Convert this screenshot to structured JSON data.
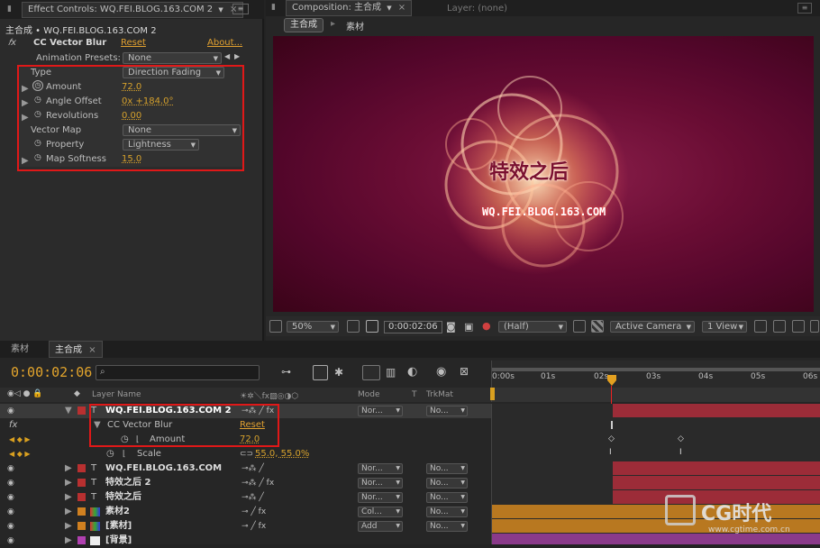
{
  "effect_panel": {
    "tab": "Effect Controls: WQ.FEI.BLOG.163.COM 2",
    "breadcrumb": "主合成 • WQ.FEI.BLOG.163.COM 2",
    "effect_name": "CC Vector Blur",
    "reset": "Reset",
    "about": "About...",
    "presets_label": "Animation Presets:",
    "presets_value": "None",
    "params": [
      {
        "label": "Type",
        "value": "Direction Fading"
      },
      {
        "label": "Amount",
        "value": "72.0"
      },
      {
        "label": "Angle Offset",
        "value": "0x +184.0°"
      },
      {
        "label": "Revolutions",
        "value": "0.00"
      },
      {
        "label": "Vector Map",
        "value": "None"
      },
      {
        "label": "Property",
        "value": "Lightness"
      },
      {
        "label": "Map Softness",
        "value": "15.0"
      }
    ]
  },
  "comp_panel": {
    "tab": "Composition: 主合成",
    "layer_tab": "Layer: (none)",
    "crumbs": [
      "主合成",
      "素材"
    ],
    "canvas_title": "特效之后",
    "canvas_subtitle": "WQ.FEI.BLOG.163.COM",
    "zoom": "50%",
    "timecode": "0:00:02:06",
    "resolution": "(Half)",
    "camera": "Active Camera",
    "view": "1 View"
  },
  "timeline": {
    "tabs": [
      "素材",
      "主合成"
    ],
    "timecode": "0:00:02:06",
    "search_placeholder": "",
    "col_layer": "Layer Name",
    "col_mode": "Mode",
    "col_t": "T",
    "col_trkmat": "TrkMat",
    "ruler": [
      "0:00s",
      "01s",
      "02s",
      "03s",
      "04s",
      "05s",
      "06s"
    ],
    "layers": [
      {
        "name": "WQ.FEI.BLOG.163.COM 2",
        "mode": "Nor...",
        "trk": "No...",
        "color": "#b83030",
        "type": "T"
      },
      {
        "name": "WQ.FEI.BLOG.163.COM",
        "mode": "Nor...",
        "trk": "No...",
        "color": "#b83030",
        "type": "T"
      },
      {
        "name": "特效之后 2",
        "mode": "Nor...",
        "trk": "No...",
        "color": "#b83030",
        "type": "T"
      },
      {
        "name": "特效之后",
        "mode": "Nor...",
        "trk": "No...",
        "color": "#b83030",
        "type": "T"
      },
      {
        "name": "素材2",
        "mode": "Col...",
        "trk": "No...",
        "color": "#d08020",
        "type": "comp"
      },
      {
        "name": "[素材]",
        "mode": "Add",
        "trk": "No...",
        "color": "#d08020",
        "type": "comp"
      },
      {
        "name": "[背景]",
        "mode": "",
        "trk": "",
        "color": "#b040b0",
        "type": "solid"
      }
    ],
    "effect_row": "CC Vector Blur",
    "effect_reset": "Reset",
    "amount_label": "Amount",
    "amount_value": "72.0",
    "scale_label": "Scale",
    "scale_value": "55.0, 55.0%"
  },
  "watermark": {
    "brand": "CG时代",
    "url": "www.cgtime.com.cn"
  }
}
